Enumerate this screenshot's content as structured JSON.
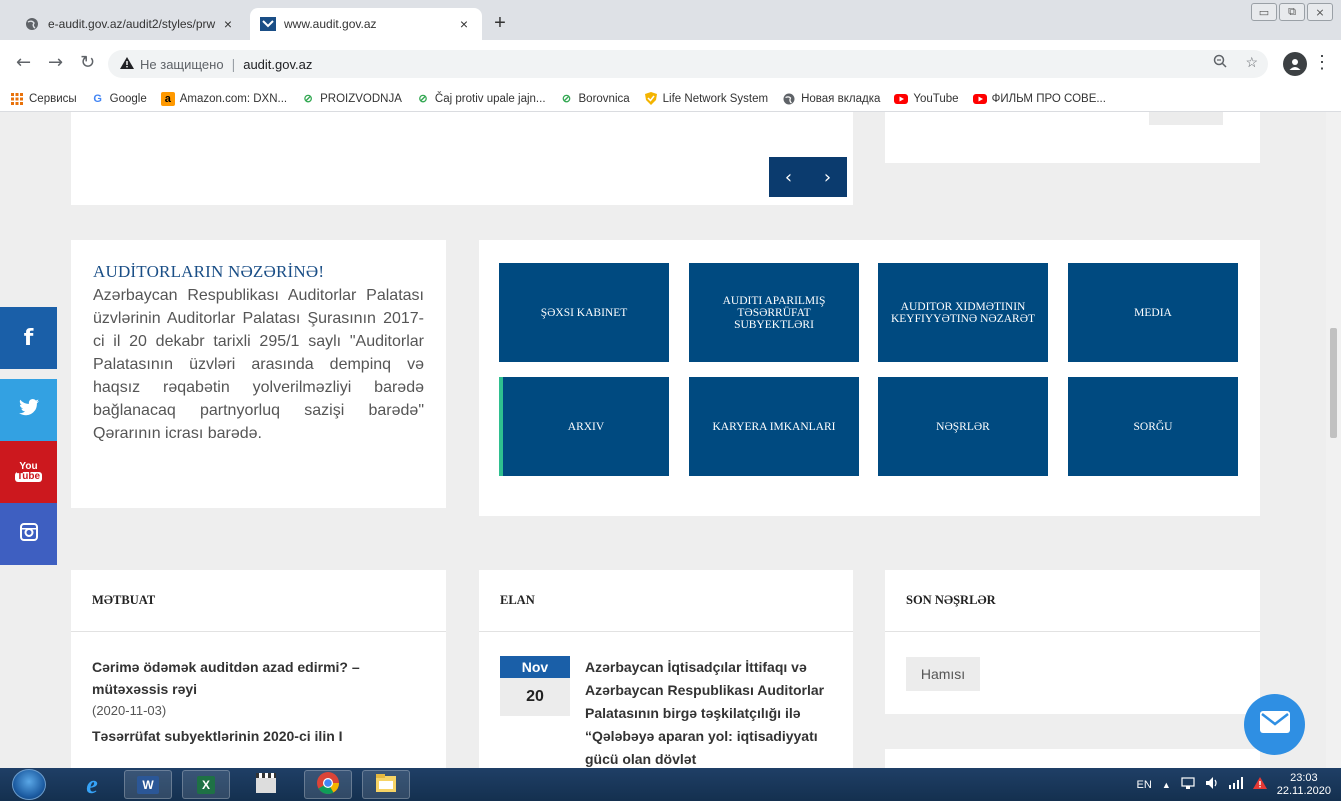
{
  "browser": {
    "tabs": [
      {
        "title": "e-audit.gov.az/audit2/styles/prw",
        "close": "×"
      },
      {
        "title": "www.audit.gov.az",
        "close": "×"
      }
    ],
    "new_tab": "+",
    "window_controls": [
      "▭",
      "⧉",
      "⨯"
    ],
    "nav": {
      "back": "←",
      "forward": "→",
      "reload": "↻"
    },
    "address": {
      "not_secure": "Не защищено",
      "url": "audit.gov.az"
    },
    "bookmarks": [
      {
        "label": "Сервисы",
        "icon": "apps-icon"
      },
      {
        "label": "Google",
        "icon": "google-icon"
      },
      {
        "label": "Amazon.com: DXN...",
        "icon": "amazon-icon"
      },
      {
        "label": "PROIZVODNJA",
        "icon": "leaf-icon"
      },
      {
        "label": "Čaj protiv upale jajn...",
        "icon": "leaf-icon"
      },
      {
        "label": "Borovnica",
        "icon": "leaf-icon"
      },
      {
        "label": "Life Network System",
        "icon": "shield-icon"
      },
      {
        "label": "Новая вкладка",
        "icon": "globe-icon"
      },
      {
        "label": "YouTube",
        "icon": "youtube-icon"
      },
      {
        "label": "ФИЛЬМ ПРО СОВЕ...",
        "icon": "youtube-icon"
      }
    ]
  },
  "slider": {
    "prev": "‹",
    "next": "›"
  },
  "notice": {
    "title": "AUDİTORLARIN NƏZƏRİNƏ!",
    "body": "Azərbaycan Respublikası Auditorlar Palatası üzvlərinin Auditorlar Palatası Şurasının 2017-ci il 20 dekabr tarixli 295/1 saylı \"Auditorlar Palatasının üzvləri arasında dempinq və haqsız rəqabətin yolverilməzliyi barədə bağlanacaq partnyorluq sazişi barədə\" Qərarının icrası barədə."
  },
  "tiles": [
    {
      "label": "ŞƏXSI KABINET"
    },
    {
      "label": "AUDITI APARILMIŞ TƏSƏRRÜFAT SUBYEKTLƏRI"
    },
    {
      "label": "AUDITOR XIDMƏTININ KEYFIYYƏTINƏ NƏZARƏT"
    },
    {
      "label": "MEDIA"
    },
    {
      "label": "ARXIV"
    },
    {
      "label": "KARYERA IMKANLARI"
    },
    {
      "label": "NƏŞRLƏR"
    },
    {
      "label": "SORĞU"
    }
  ],
  "social": {
    "facebook": "f",
    "youtube_top": "You",
    "youtube_bottom": "Tube"
  },
  "press": {
    "heading": "MƏTBUAT",
    "items": [
      {
        "title": "Cərimə ödəmək auditdən azad edirmi? – mütəxəssis rəyi",
        "date": "(2020-11-03)"
      },
      {
        "title": "Təsərrüfat subyektlərinin 2020-ci ilin I",
        "date": ""
      }
    ]
  },
  "elan": {
    "heading": "ELAN",
    "month": "Nov",
    "day": "20",
    "text": "Azərbaycan İqtisadçılar İttifaqı və Azərbaycan Respublikası Auditorlar Palatasının birgə təşkilatçılığı ilə “Qələbəyə aparan yol: iqtisadiyyatı gücü olan dövlət"
  },
  "recent": {
    "heading": "SON NƏŞRLƏR",
    "all_button": "Hamısı"
  },
  "taskbar": {
    "language": "EN",
    "time": "23:03",
    "date": "22.11.2020",
    "tray_arrow": "▲"
  },
  "colors": {
    "tile_blue": "#004a80",
    "accent_green": "#2fbf8f",
    "facebook": "#1a5fa8",
    "twitter": "#33a1e2",
    "youtube": "#cc181e",
    "instagram": "#3e5fc1",
    "chat": "#2f8fe3"
  }
}
